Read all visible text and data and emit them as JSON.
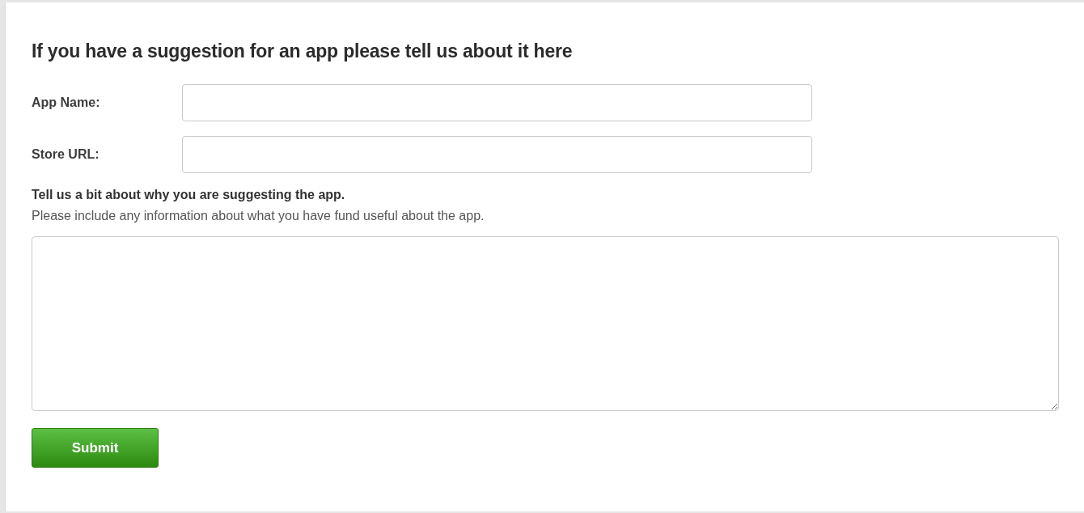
{
  "heading": "If you have a suggestion for an app please tell us about it here",
  "fields": [
    {
      "label": "App Name:"
    },
    {
      "label": "Store URL:"
    }
  ],
  "reason": {
    "label": "Tell us a bit about why you are suggesting the app.",
    "hint": "Please include any information about what you have fund useful about the app."
  },
  "submit": "Submit"
}
